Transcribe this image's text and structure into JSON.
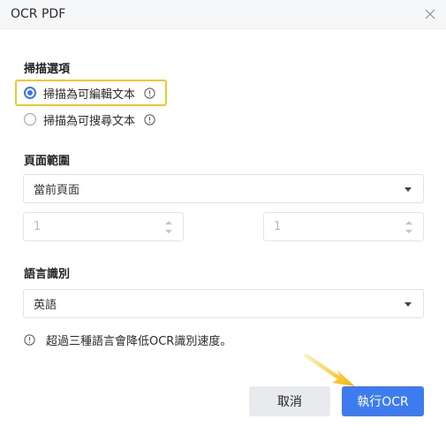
{
  "window": {
    "title": "OCR PDF"
  },
  "scan_options": {
    "label": "掃描選項",
    "options": [
      {
        "label": "掃描為可編輯文本",
        "selected": true
      },
      {
        "label": "掃描為可搜尋文本",
        "selected": false
      }
    ]
  },
  "page_range": {
    "label": "頁面範圍",
    "selected": "當前頁面",
    "from_value": "1",
    "to_value": "1"
  },
  "language": {
    "label": "語言識別",
    "selected": "英語"
  },
  "note": {
    "text": "超過三種語言會降低OCR識別速度。"
  },
  "buttons": {
    "cancel": "取消",
    "ok": "執行OCR"
  },
  "colors": {
    "accent": "#3d7bf0",
    "highlight": "#f5c52c",
    "arrow": "#f5b800"
  }
}
